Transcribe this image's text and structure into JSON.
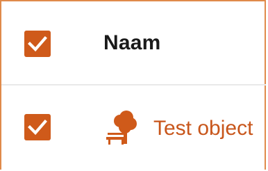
{
  "table": {
    "header": {
      "select_all_checked": true,
      "column_name": "Naam"
    },
    "rows": [
      {
        "checked": true,
        "icon": "tree-bench-icon",
        "name": "Test object"
      }
    ]
  },
  "colors": {
    "accent": "#cf5a1a",
    "link": "#c8561b",
    "border": "#e08a4a",
    "divider": "#e9e9e9"
  }
}
